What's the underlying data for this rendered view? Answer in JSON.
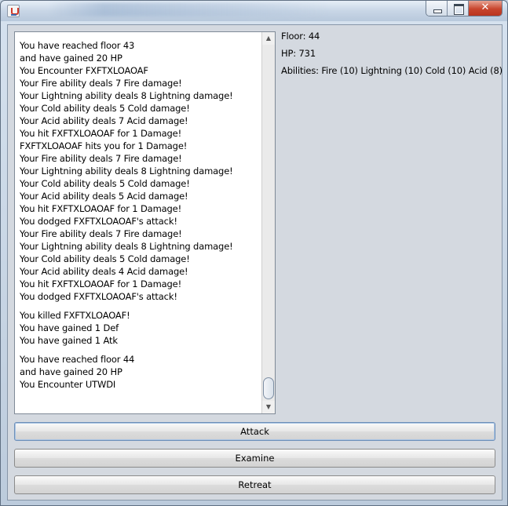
{
  "window": {
    "close_glyph": "✕"
  },
  "log": {
    "lines": [
      " You have reached floor 43",
      "and have gained 20 HP",
      "You Encounter FXFTXLOAOAF",
      "Your Fire ability deals 7 Fire damage!",
      "Your Lightning ability deals 8 Lightning damage!",
      "Your Cold ability deals 5 Cold damage!",
      "Your Acid ability deals 7 Acid damage!",
      "You hit FXFTXLOAOAF for 1 Damage!",
      "FXFTXLOAOAF hits you for 1 Damage!",
      "Your Fire ability deals 7 Fire damage!",
      "Your Lightning ability deals 8 Lightning damage!",
      "Your Cold ability deals 5 Cold damage!",
      "Your Acid ability deals 5 Acid damage!",
      "You hit FXFTXLOAOAF for 1 Damage!",
      "You dodged FXFTXLOAOAF's attack!",
      "Your Fire ability deals 7 Fire damage!",
      "Your Lightning ability deals 8 Lightning damage!",
      "Your Cold ability deals 5 Cold damage!",
      "Your Acid ability deals 4 Acid damage!",
      "You hit FXFTXLOAOAF for 1 Damage!",
      "You dodged FXFTXLOAOAF's attack!",
      "",
      " You killed FXFTXLOAOAF!",
      "You have gained 1 Def",
      "You have gained 1 Atk",
      "",
      " You have reached floor 44",
      "and have gained 20 HP",
      "You Encounter UTWDI"
    ]
  },
  "stats": {
    "floor": "Floor: 44",
    "hp": "HP: 731",
    "abilities": "Abilities: Fire (10) Lightning (10) Cold (10) Acid (8)"
  },
  "actions": {
    "attack": "Attack",
    "examine": "Examine",
    "retreat": "Retreat"
  }
}
